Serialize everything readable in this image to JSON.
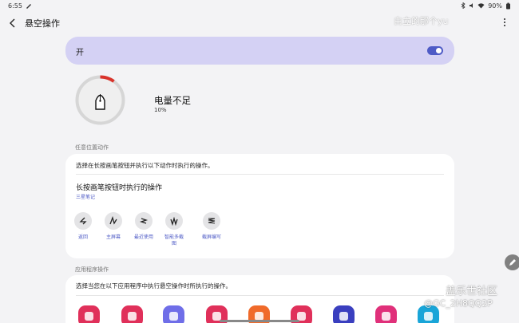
{
  "status_bar": {
    "time": "6:55",
    "battery": "90%"
  },
  "header": {
    "title": "悬空操作",
    "watermark": "白立的那个yu"
  },
  "main_switch": {
    "label": "开",
    "enabled": true,
    "accent": "#4e5bc6"
  },
  "pen_status": {
    "title": "电量不足",
    "level": "10%",
    "level_value": 0.1,
    "ring_color": "#d9332b"
  },
  "anywhere_actions": {
    "section_title": "任意位置动作",
    "description": "选择在长按画笔按钮并执行以下动作时执行的操作。",
    "long_press_title": "长按画笔按钮时执行的操作",
    "long_press_value": "三星笔记",
    "actions": [
      {
        "label": "返回",
        "icon": "back-gesture-icon"
      },
      {
        "label": "主屏幕",
        "icon": "home-gesture-icon"
      },
      {
        "label": "最近使用",
        "icon": "recents-gesture-icon"
      },
      {
        "label": "智能多截",
        "label2": "图",
        "icon": "smart-select-gesture-icon"
      },
      {
        "label": "截屏编写",
        "icon": "screen-write-gesture-icon"
      }
    ]
  },
  "app_actions": {
    "section_title": "应用程序操作",
    "description": "选择当您在以下应用程序中执行悬空操作时所执行的操作。",
    "apps": [
      {
        "icon": "camera-app-icon",
        "color": "#e0305a"
      },
      {
        "icon": "gallery-app-icon",
        "color": "#e0305a"
      },
      {
        "icon": "internet-app-icon",
        "color": "#6f6ee8"
      },
      {
        "icon": "voice-recorder-app-icon",
        "color": "#e0305a"
      },
      {
        "icon": "my-files-app-icon",
        "color": "#f06a2a"
      },
      {
        "icon": "music-app-icon",
        "color": "#e0305a"
      },
      {
        "icon": "video-app-icon",
        "color": "#3a3fbf"
      },
      {
        "icon": "media-app-icon",
        "color": "#e0307a"
      },
      {
        "icon": "bixby-app-icon",
        "color": "#19a5d8"
      }
    ]
  },
  "watermark_bottom": {
    "site": "盖乐世社区",
    "user": "@GC_2H8QQ2P"
  }
}
